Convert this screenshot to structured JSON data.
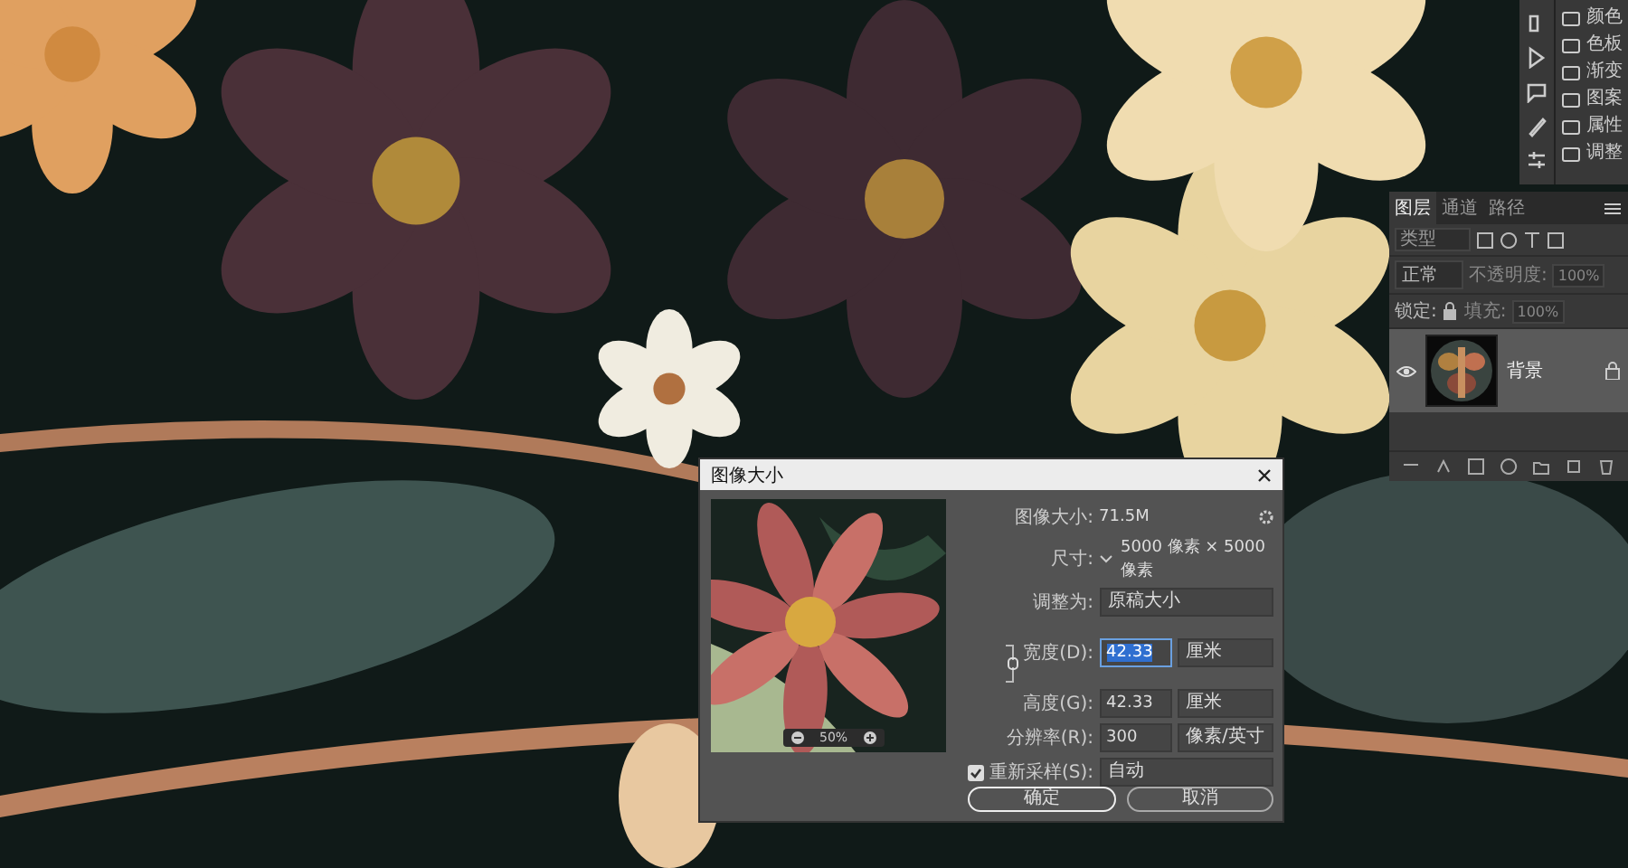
{
  "side_panels": [
    {
      "label": "颜色"
    },
    {
      "label": "色板"
    },
    {
      "label": "渐变"
    },
    {
      "label": "图案"
    },
    {
      "label": "属性"
    },
    {
      "label": "调整"
    }
  ],
  "layers_panel": {
    "tabs": [
      {
        "label": "图层",
        "selected": true
      },
      {
        "label": "通道",
        "selected": false
      },
      {
        "label": "路径",
        "selected": false
      }
    ],
    "filter": {
      "placeholder": "类型"
    },
    "blend_mode": "正常",
    "opacity_label": "不透明度:",
    "opacity": "100%",
    "lock_label": "锁定:",
    "fill_label": "填充:",
    "fill": "100%",
    "layers": [
      {
        "name": "背景",
        "visible": true,
        "locked": true,
        "selected": true
      }
    ]
  },
  "dialog": {
    "title": "图像大小",
    "size_label": "图像大小:",
    "size": "71.5M",
    "dimensions_label": "尺寸:",
    "dimensions": "5000 像素 × 5000 像素",
    "fit_label": "调整为:",
    "fit": "原稿大小",
    "fields": [
      {
        "label": "宽度(D):",
        "value": "42.33",
        "unit": "厘米",
        "selected": true
      },
      {
        "label": "高度(G):",
        "value": "42.33",
        "unit": "厘米",
        "selected": false
      },
      {
        "label": "分辨率(R):",
        "value": "300",
        "unit": "像素/英寸",
        "selected": false
      }
    ],
    "resample": {
      "label": "重新采样(S):",
      "checked": true,
      "value": "自动"
    },
    "preview": {
      "kind": "picture",
      "zoom": "50%"
    },
    "buttons": [
      {
        "label": "确定",
        "kind": "default"
      },
      {
        "label": "取消",
        "kind": "normal"
      }
    ]
  }
}
